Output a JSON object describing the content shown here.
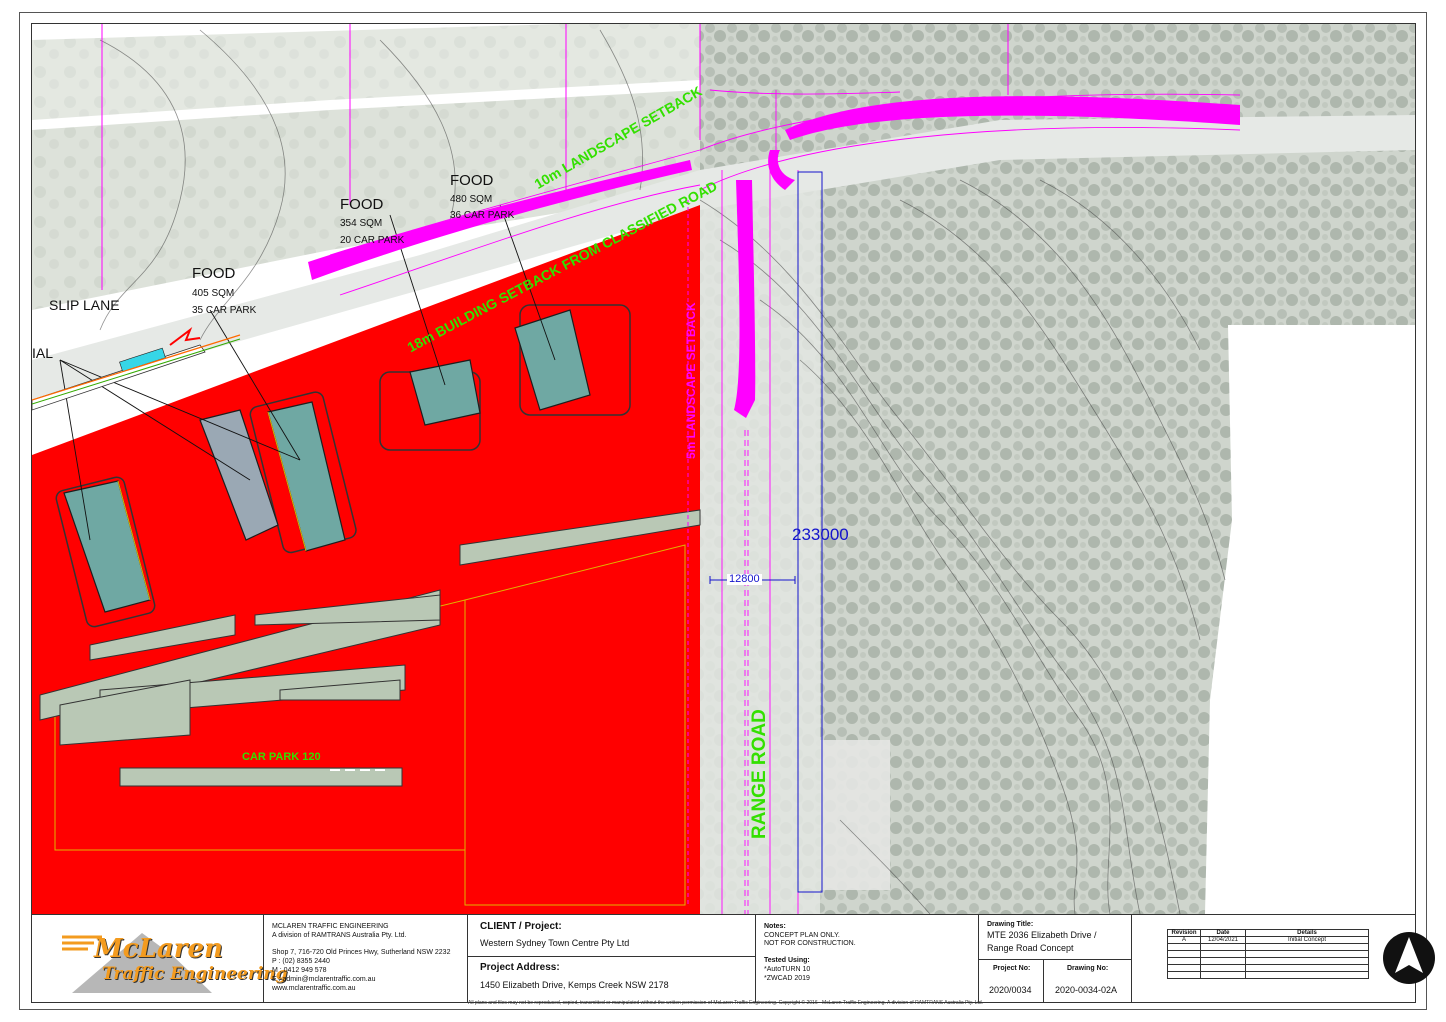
{
  "plan": {
    "labels": {
      "slip_lane": "SLIP LANE",
      "cut_left": "IAL",
      "food1_title": "FOOD",
      "food1_area": "405 SQM",
      "food1_parking": "35 CAR PARK",
      "food2_title": "FOOD",
      "food2_area": "354 SQM",
      "food2_parking": "20 CAR PARK",
      "food3_title": "FOOD",
      "food3_area": "480 SQM",
      "food3_parking": "36 CAR PARK",
      "setback_landscape_10m": "10m LANDSCAPE SETBACK",
      "setback_building_18m": "18m BUILDING SETBACK FROM CLASSIFIED ROAD",
      "setback_landscape_5m": "5m LANDSCAPE SETBACK",
      "dim_233000": "233000",
      "dim_12800": "12800",
      "car_park_120": "CAR PARK 120",
      "range_road": "RANGE ROAD"
    },
    "colors": {
      "site_fill": "#ff0000",
      "road_markup": "#ff00ff",
      "dimension": "#1414cc",
      "setback_text": "#33e000",
      "building_fill": "#6fa8a3",
      "aerial_tint": "#c9d0c8"
    }
  },
  "title_block": {
    "company": {
      "logo_name": "McLaren",
      "logo_sub": "Traffic Engineering",
      "name": "MCLAREN TRAFFIC ENGINEERING",
      "division": "A division of RAMTRANS Australia Pty. Ltd.",
      "address": "Shop 7, 716-720 Old Princes Hwy, Sutherland NSW 2232",
      "phone": "P : (02) 8355 2440",
      "mobile": "M : 0412 949 578",
      "email": "E : admin@mclarentraffic.com.au",
      "web": "www.mclarentraffic.com.au"
    },
    "client_label": "CLIENT / Project:",
    "client_value": "Western Sydney Town Centre Pty Ltd",
    "address_label": "Project Address:",
    "address_value": "1450 Elizabeth Drive, Kemps Creek NSW 2178",
    "disclaimer": "All plans and files may not be reproduced, copied, transmitted or manipulated without the written permission of McLaren Traffic Engineering. Copyright © 2016 - McLaren Traffic Engineering. A division of RAMTRANS Australia Pty. Ltd.",
    "notes_label": "Notes:",
    "notes_line1": "CONCEPT PLAN ONLY.",
    "notes_line2": "NOT FOR CONSTRUCTION.",
    "tested_label": "Tested Using:",
    "tested_line1": "*AutoTURN 10",
    "tested_line2": "*ZWCAD 2019",
    "drawing_title_label": "Drawing Title:",
    "drawing_title_line1": "MTE 2036 Elizabeth Drive /",
    "drawing_title_line2": "Range Road Concept",
    "project_no_label": "Project No:",
    "project_no_value": "2020/0034",
    "drawing_no_label": "Drawing No:",
    "drawing_no_value": "2020-0034-02A",
    "revision_table": {
      "headers": [
        "Revision",
        "Date",
        "Details"
      ],
      "rows": [
        [
          "A",
          "12/04/2021",
          "Initial Concept"
        ]
      ]
    }
  }
}
